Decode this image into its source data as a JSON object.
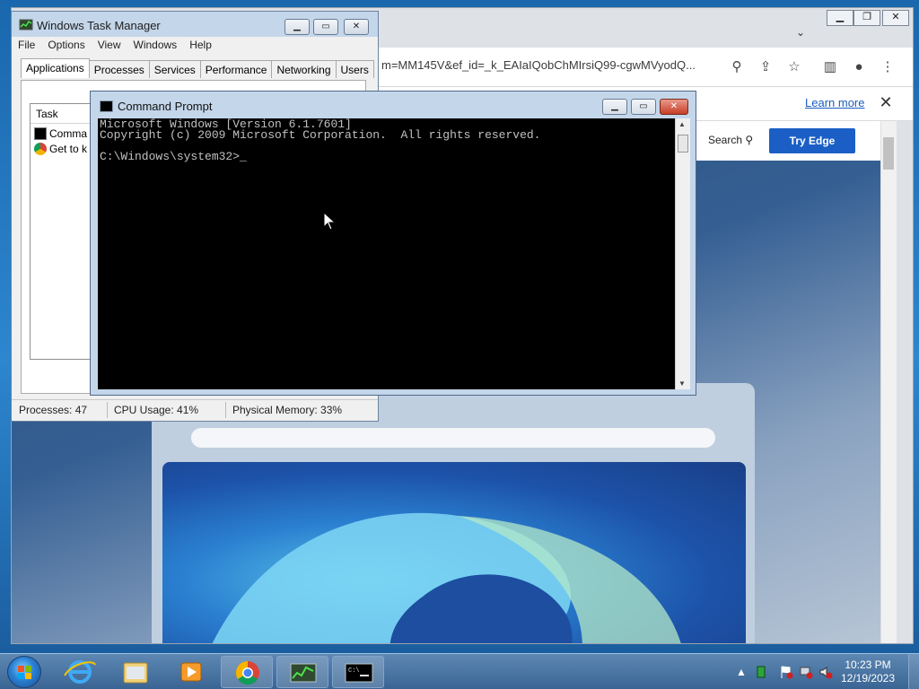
{
  "browser": {
    "url": "m=MM145V&ef_id=_k_EAIaIQobChMIrsiQ99-cgwMVyodQ...",
    "infobar_link": "Learn more",
    "page_search": "Search",
    "page_cta": "Try Edge"
  },
  "taskmgr": {
    "title": "Windows Task Manager",
    "menu": [
      "File",
      "Options",
      "View",
      "Windows",
      "Help"
    ],
    "tabs": [
      "Applications",
      "Processes",
      "Services",
      "Performance",
      "Networking",
      "Users"
    ],
    "active_tab": "Applications",
    "task_header": "Task",
    "tasks": [
      "Comma",
      "Get to k"
    ],
    "status": {
      "processes": "Processes: 47",
      "cpu": "CPU Usage: 41%",
      "memory": "Physical Memory: 33%"
    }
  },
  "cmd": {
    "title": "Command Prompt",
    "line1": "Microsoft Windows [Version 6.1.7601]",
    "line2": "Copyright (c) 2009 Microsoft Corporation.  All rights reserved.",
    "prompt": "C:\\Windows\\system32>_"
  },
  "taskbar": {
    "time": "10:23 PM",
    "date": "12/19/2023"
  },
  "colors": {
    "cta_blue": "#1b5fc6",
    "console_bg": "#000000",
    "console_text": "#c0c0c0"
  }
}
